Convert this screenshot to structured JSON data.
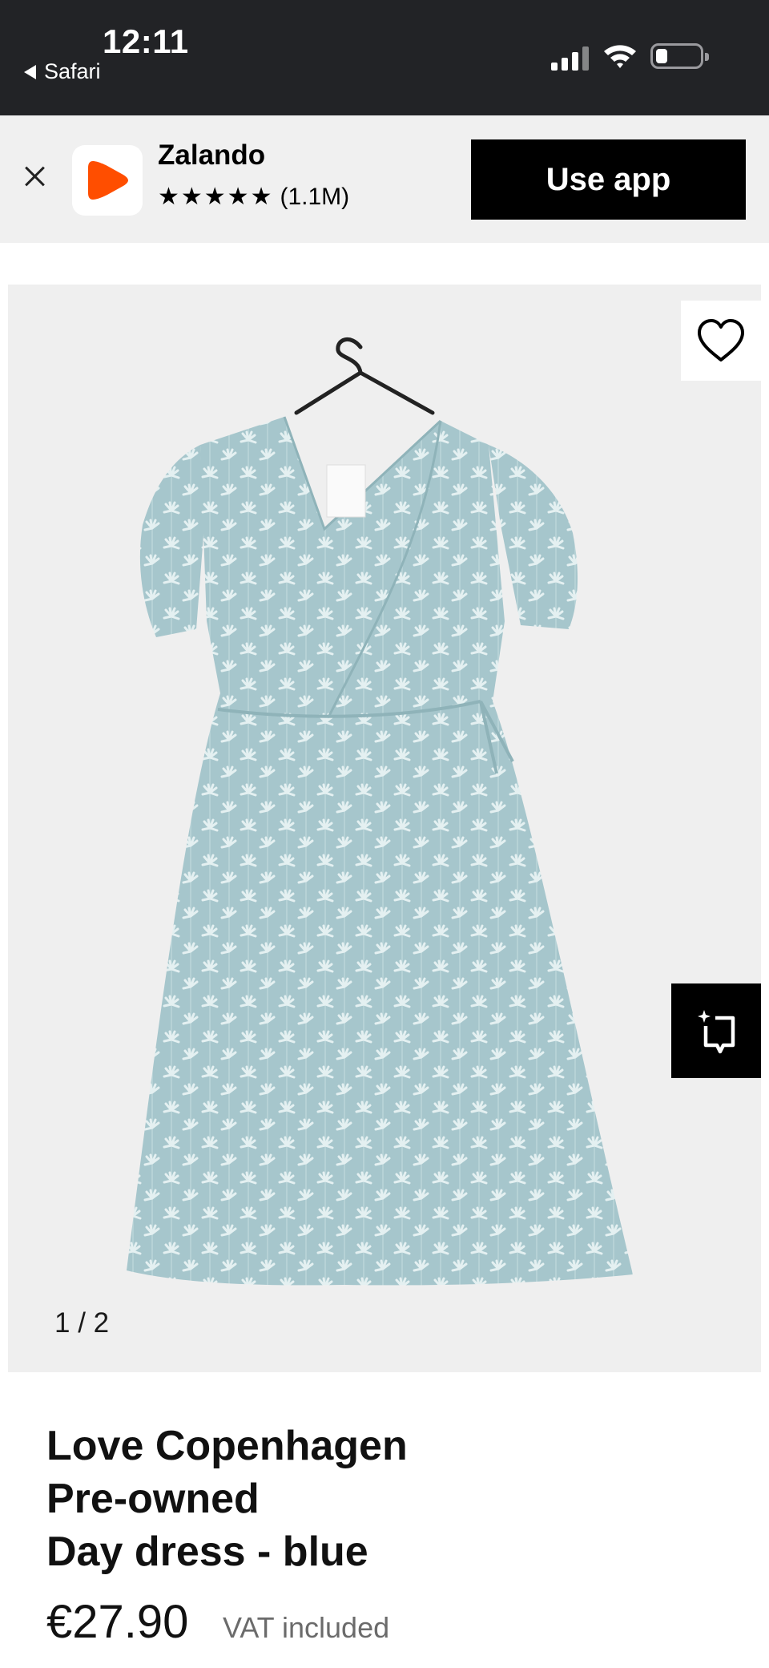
{
  "status_bar": {
    "time": "12:11",
    "back_app": "Safari",
    "icons": [
      "cellular-signal-icon",
      "wifi-icon",
      "battery-icon"
    ]
  },
  "app_banner": {
    "app_name": "Zalando",
    "rating_stars": "★★★★★",
    "rating_count": "(1.1M)",
    "cta_label": "Use app",
    "logo_color": "#ff4e00",
    "icons": [
      "close-icon",
      "zalando-logo-icon"
    ]
  },
  "gallery": {
    "counter": "1 / 2",
    "icons": [
      "heart-icon",
      "similar-items-icon"
    ],
    "dress_color": "#a6c6cc"
  },
  "product": {
    "brand": "Love Copenhagen",
    "condition": "Pre-owned",
    "name": "Day dress - blue",
    "price": "€27.90",
    "vat_note": "VAT included"
  }
}
